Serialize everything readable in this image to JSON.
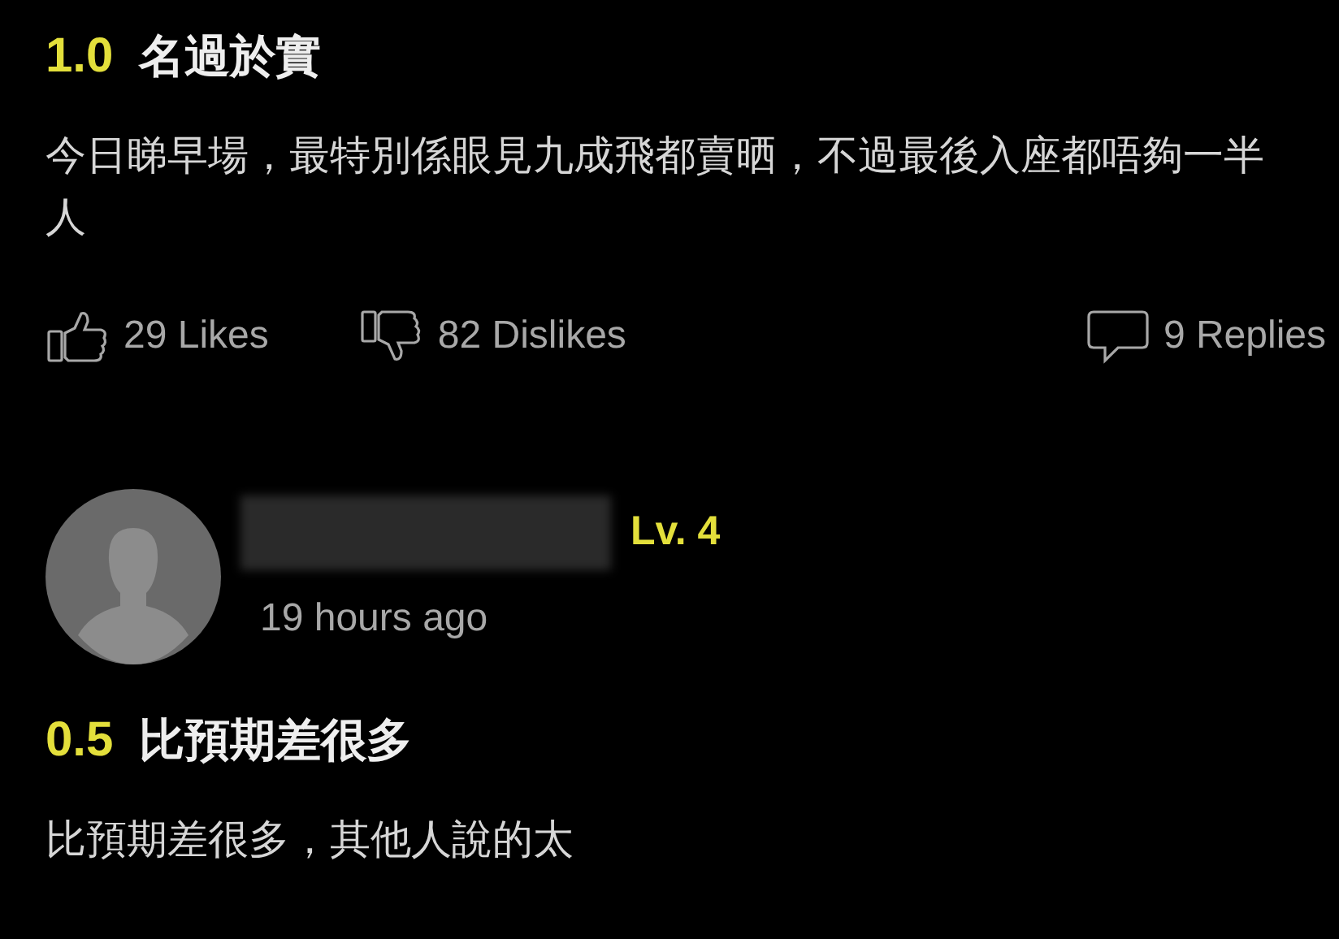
{
  "reviews": [
    {
      "score": "1.0",
      "title": "名過於實",
      "body": "今日睇早場，最特別係眼見九成飛都賣晒，不過最後入座都唔夠一半人",
      "likes": "29 Likes",
      "dislikes": "82 Dislikes",
      "replies": "9 Replies"
    },
    {
      "user": {
        "level": "Lv. 4",
        "time": "19 hours ago"
      },
      "score": "0.5",
      "title": "比預期差很多",
      "body": "比預期差很多，其他人說的太"
    }
  ]
}
